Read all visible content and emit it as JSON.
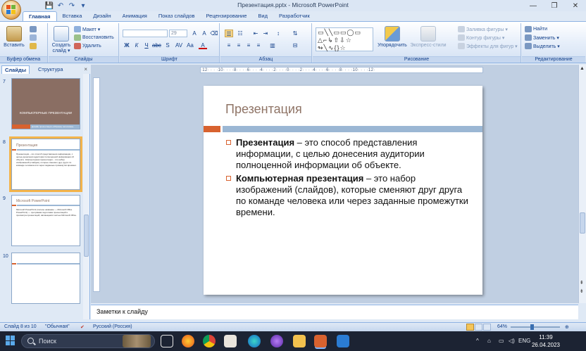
{
  "window": {
    "title": "Презентация.pptx - Microsoft PowerPoint",
    "controls": [
      "—",
      "❐",
      "✕"
    ]
  },
  "qat": {
    "save": "💾",
    "undo": "↶",
    "redo": "↷",
    "more": "▾"
  },
  "tabs": [
    "Главная",
    "Вставка",
    "Дизайн",
    "Анимация",
    "Показ слайдов",
    "Рецензирование",
    "Вид",
    "Разработчик"
  ],
  "ribbon": {
    "clipboard": {
      "label": "Буфер обмена",
      "paste": "Вставить"
    },
    "slides": {
      "label": "Слайды",
      "create": "Создать",
      "create2": "слайд ▾",
      "layout": "Макет ▾",
      "reset": "Восстановить",
      "delete": "Удалить"
    },
    "font": {
      "label": "Шрифт",
      "font_name": "",
      "font_size": "29"
    },
    "paragraph": {
      "label": "Абзац"
    },
    "drawing": {
      "label": "Рисование",
      "arrange": "Упорядочить",
      "quick_styles": "Экспресс-стили",
      "fill": "Заливка фигуры ▾",
      "outline": "Контур фигуры ▾",
      "effects": "Эффекты для фигур ▾"
    },
    "editing": {
      "label": "Редактирование",
      "find": "Найти",
      "replace": "Заменить ▾",
      "select": "Выделить ▾"
    }
  },
  "left_panel": {
    "tab_slides": "Слайды",
    "tab_outline": "Структура",
    "close": "×",
    "thumbnails": [
      {
        "num": "7",
        "title": "КОМПЬЮТЕРНЫЕ ПРЕЗЕНТАЦИИ",
        "subtitle": "Дизайн презентации «Образец заголовка»"
      },
      {
        "num": "8",
        "title": "Презентация",
        "text": "Презентация – это способ представления информации, с целью донесения аудитории полноценной информации об объекте. Компьютерная презентация – это набор изображений (слайдов), которые сменяют друг друга по команде человека или через заданные промежутки времени."
      },
      {
        "num": "9",
        "title": "Microsoft PowerPoint",
        "text": "Microsoft PowerPoint (полное название — Microsoft Office PowerPoint) — программа подготовки презентаций и просмотра презентаций, являющаяся частью Microsoft Office."
      },
      {
        "num": "10"
      }
    ]
  },
  "slide": {
    "title": "Презентация",
    "b1_bold": "Презентация",
    "b1_rest": " – это способ представления информации, с целью донесения аудитории полноценной информации об объекте.",
    "b2_bold": "Компьютерная презентация",
    "b2_rest": " – это набор изображений (слайдов), которые сменяют друг друга по команде человека или через заданные промежутки времени.",
    "accent_color": "#d8622f",
    "bar_color": "#9bb7d4"
  },
  "ruler": {
    "h": "·12· · · ·10· · · ·8· · · ·6· · · ·4· · · ·2· · · ·0· · · ·2· · · ·4· · · ·6· · · ·8· · · ·10· · · ·12·"
  },
  "notes": {
    "placeholder": "Заметки к слайду"
  },
  "status": {
    "slide_of": "Слайд 8 из 10",
    "theme": "\"Обычная\"",
    "language": "Русский (Россия)",
    "zoom": "64%"
  },
  "taskbar": {
    "search": "Поиск",
    "lang": "ENG",
    "time": "11:39",
    "date": "26.04.2023"
  }
}
